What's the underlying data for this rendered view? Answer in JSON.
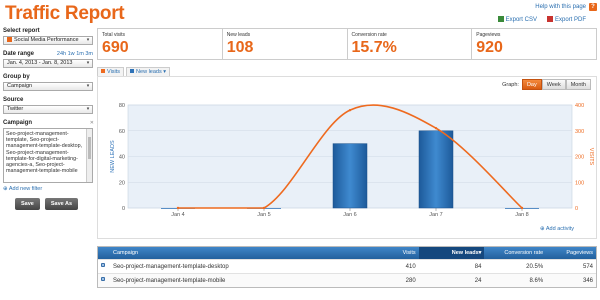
{
  "header": {
    "title": "Traffic Report",
    "help_link": "Help with this page",
    "export_csv": "Export CSV",
    "export_pdf": "Export PDF"
  },
  "sidebar": {
    "report": {
      "label": "Select report",
      "value": "Social Media Performance"
    },
    "date_range": {
      "label": "Date range",
      "quick": [
        "24h",
        "1w",
        "1m",
        "3m"
      ],
      "value": "Jan. 4, 2013 - Jan. 8, 2013"
    },
    "group_by": {
      "label": "Group by",
      "value": "Campaign"
    },
    "source": {
      "label": "Source",
      "value": "Twitter"
    },
    "campaign": {
      "label": "Campaign",
      "text": "Seo-project-management-template, Seo-project-management-template-desktop, Seo-project-management-template-for-digital-marketing-agencies-a, Seo-project-management-template-mobile"
    },
    "add_filter": "Add new filter",
    "save": "Save",
    "save_as": "Save As"
  },
  "kpis": [
    {
      "label": "Total visits",
      "value": "690"
    },
    {
      "label": "New leads",
      "value": "108"
    },
    {
      "label": "Conversion rate",
      "value": "15.7%"
    },
    {
      "label": "Pageviews",
      "value": "920"
    }
  ],
  "tabs": {
    "visits": "Visits",
    "new_leads": "New leads"
  },
  "graph": {
    "label": "Graph:",
    "day": "Day",
    "week": "Week",
    "month": "Month",
    "active": "Day"
  },
  "add_activity": "Add activity",
  "chart_data": {
    "type": "bar",
    "categories": [
      "Jan 4",
      "Jan 5",
      "Jan 6",
      "Jan 7",
      "Jan 8"
    ],
    "series": [
      {
        "name": "NEW LEADS",
        "type": "bar",
        "axis": "left",
        "color": "#2f73b8",
        "values": [
          0,
          0,
          50,
          60,
          0
        ]
      },
      {
        "name": "VISITS",
        "type": "line",
        "axis": "right",
        "color": "#ee6a1f",
        "values": [
          0,
          0,
          380,
          310,
          0
        ]
      }
    ],
    "ylabel": "NEW LEADS",
    "y2label": "VISITS",
    "ylim": [
      0,
      80
    ],
    "y2lim": [
      0,
      400
    ],
    "yticks": [
      "0",
      "20",
      "40",
      "60",
      "80"
    ],
    "y2ticks": [
      "0",
      "100",
      "200",
      "300",
      "400"
    ],
    "grid": true
  },
  "table": {
    "headers": {
      "campaign": "Campaign",
      "visits": "Visits",
      "leads": "New leads",
      "conv": "Conversion rate",
      "pv": "Pageviews"
    },
    "rows": [
      {
        "campaign": "Seo-project-management-template-desktop",
        "visits": "410",
        "leads": "84",
        "conv": "20.5%",
        "pv": "574"
      },
      {
        "campaign": "Seo-project-management-template-mobile",
        "visits": "280",
        "leads": "24",
        "conv": "8.6%",
        "pv": "346"
      }
    ]
  },
  "colors": {
    "accent": "#e8671a",
    "link": "#2a6fb0",
    "bar": "#2f73b8",
    "line": "#ee6a1f"
  }
}
